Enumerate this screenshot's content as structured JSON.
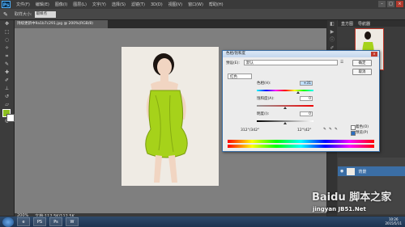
{
  "menubar": {
    "logo": "Ps",
    "items": [
      "文件(F)",
      "编辑(E)",
      "图像(I)",
      "图层(L)",
      "文字(Y)",
      "选择(S)",
      "滤镜(T)",
      "3D(D)",
      "视图(V)",
      "窗口(W)",
      "帮助(H)"
    ],
    "min": "–",
    "max": "□",
    "close": "×"
  },
  "options": {
    "tool_icon": "eyedropper-icon",
    "sample_label": "取样大小:",
    "sample_value": "取样点"
  },
  "document": {
    "tab_label": "持续更新中9a1b7c291.jpg @ 200%(RGB/8)",
    "zoom": "200%",
    "doc_info": "文档:112.5K/112.5K"
  },
  "panels": {
    "nav_tabs": [
      "直方图",
      "导航器"
    ],
    "nav_zoom": "200%",
    "layer_name": "背景"
  },
  "dialog": {
    "title": "色相/饱和度",
    "preset_label": "预设(E):",
    "preset_value": "默认",
    "ok_label": "确定",
    "cancel_label": "取消",
    "channel_value": "红色",
    "hue_label": "色相(H):",
    "hue_value": "+31",
    "saturation_label": "饱和度(A):",
    "saturation_value": "0",
    "lightness_label": "明度(I):",
    "lightness_value": "0",
    "colorize_label": "着色(O)",
    "preview_label": "预览(P)",
    "range_left": "312°/342°",
    "range_right": "12°\\42°"
  },
  "taskbar": {
    "items": [
      "e",
      "PS",
      "Ps",
      "W"
    ],
    "clock_time": "10:26",
    "clock_date": "2015/5/11"
  },
  "watermark": {
    "main": "Baidu 脚本之家",
    "sub": "jingyan  JB51.Net"
  },
  "colors": {
    "foreground": "#8cbf1e",
    "background": "#ffffff",
    "dress": "#a6d21a"
  }
}
